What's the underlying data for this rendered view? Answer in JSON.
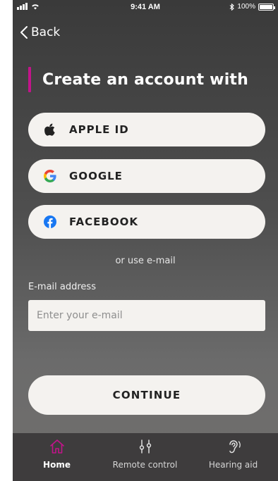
{
  "status_bar": {
    "time": "9:41 AM",
    "battery_percent": "100%",
    "icons": [
      "signal-icon",
      "wifi-icon",
      "bluetooth-icon",
      "battery-icon"
    ]
  },
  "nav": {
    "back_label": "Back"
  },
  "title": "Create an account with",
  "providers": [
    {
      "label": "APPLE ID",
      "icon": "apple-icon"
    },
    {
      "label": "GOOGLE",
      "icon": "google-icon"
    },
    {
      "label": "FACEBOOK",
      "icon": "facebook-icon"
    }
  ],
  "or_text": "or use e-mail",
  "email": {
    "label": "E-mail address",
    "placeholder": "Enter your e-mail",
    "value": ""
  },
  "continue_label": "CONTINUE",
  "tabbar": {
    "items": [
      {
        "label": "Home",
        "icon": "home-icon",
        "active": true
      },
      {
        "label": "Remote control",
        "icon": "sliders-icon",
        "active": false
      },
      {
        "label": "Hearing aid",
        "icon": "ear-icon",
        "active": false
      }
    ]
  },
  "colors": {
    "accent": "#c2148a",
    "button_bg": "#f4f2ef",
    "tabbar_bg": "#3e3c3d",
    "google_blue": "#4285F4",
    "google_red": "#EA4335",
    "google_yellow": "#FBBC05",
    "google_green": "#34A853",
    "facebook_blue": "#1877F2"
  }
}
